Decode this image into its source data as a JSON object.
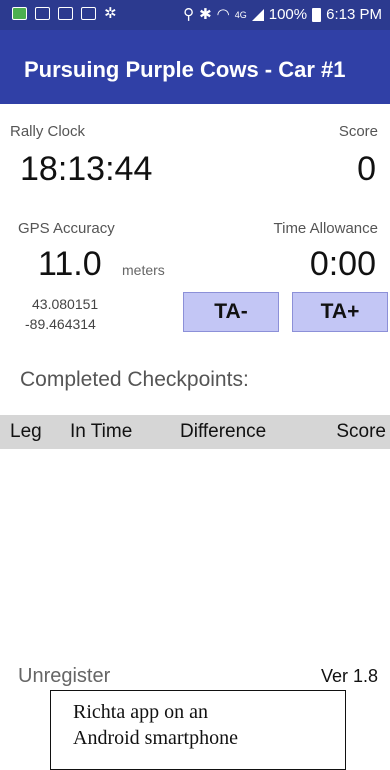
{
  "status_bar": {
    "left_icons": [
      "app-notification-icon",
      "mail-icon",
      "email-icon",
      "image-icon",
      "fan-icon"
    ],
    "right_icons": [
      "location-icon",
      "bluetooth-icon",
      "wifi-icon",
      "4g-icon",
      "signal-icon"
    ],
    "battery": "100%",
    "time": "6:13 PM"
  },
  "app_bar": {
    "title": "Pursuing Purple Cows - Car #1"
  },
  "rally_clock": {
    "label": "Rally Clock",
    "value": "18:13:44"
  },
  "score": {
    "label": "Score",
    "value": "0"
  },
  "gps": {
    "label": "GPS Accuracy",
    "value": "11.0",
    "unit": "meters",
    "latitude": "43.080151",
    "longitude": "-89.464314"
  },
  "time_allowance": {
    "label": "Time Allowance",
    "value": "0:00"
  },
  "buttons": {
    "ta_minus": "TA-",
    "ta_plus": "TA+"
  },
  "checkpoints": {
    "title": "Completed Checkpoints:",
    "columns": [
      "Leg",
      "In Time",
      "Difference",
      "Score"
    ],
    "rows": []
  },
  "footer": {
    "unregister": "Unregister",
    "version": "Ver 1.8"
  },
  "caption": {
    "line1": "Richta app on an",
    "line2": "Android smartphone"
  },
  "colors": {
    "app_bar": "#3040a6",
    "status_bar": "#2c3a8f",
    "button": "#c3c6f5",
    "table_header": "#d6d6d6"
  }
}
